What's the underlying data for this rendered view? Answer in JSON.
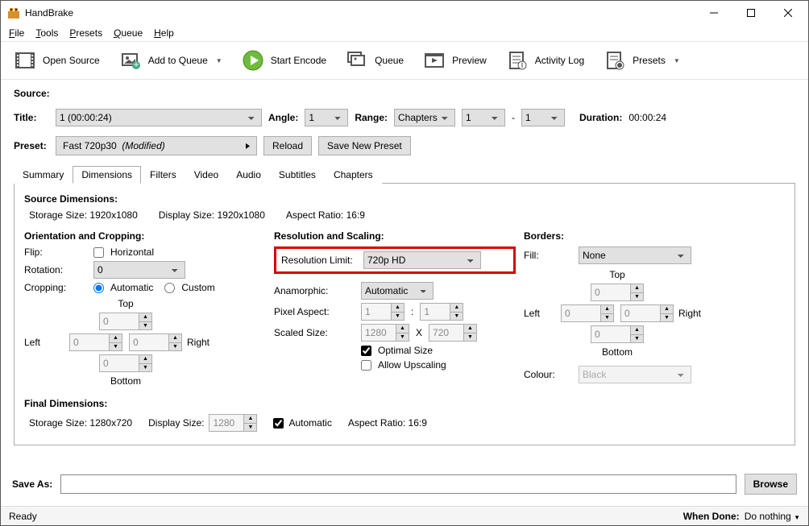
{
  "window": {
    "title": "HandBrake"
  },
  "menubar": {
    "file": "File",
    "tools": "Tools",
    "presets": "Presets",
    "queue": "Queue",
    "help": "Help"
  },
  "toolbar": {
    "open_source": "Open Source",
    "add_queue": "Add to Queue",
    "start_encode": "Start Encode",
    "queue": "Queue",
    "preview": "Preview",
    "activity": "Activity Log",
    "presets": "Presets"
  },
  "sourceRow": {
    "label": "Source:"
  },
  "titleRow": {
    "label": "Title:",
    "title_value": "1  (00:00:24)",
    "angle_label": "Angle:",
    "angle_value": "1",
    "range_label": "Range:",
    "range_type": "Chapters",
    "range_from": "1",
    "range_sep": "-",
    "range_to": "1",
    "duration_label": "Duration:",
    "duration_value": "00:00:24"
  },
  "presetRow": {
    "label": "Preset:",
    "value": "Fast 720p30",
    "modified": "(Modified)",
    "reload": "Reload",
    "save_new": "Save New Preset"
  },
  "tabs": {
    "summary": "Summary",
    "dimensions": "Dimensions",
    "filters": "Filters",
    "video": "Video",
    "audio": "Audio",
    "subtitles": "Subtitles",
    "chapters": "Chapters"
  },
  "dimensions": {
    "source_head": "Source Dimensions:",
    "storage_size_lbl": "Storage Size:",
    "storage_size_val": "1920x1080",
    "display_size_lbl": "Display Size:",
    "display_size_val": "1920x1080",
    "aspect_lbl": "Aspect Ratio:",
    "aspect_val": "16:9",
    "orient_head": "Orientation and Cropping:",
    "flip_lbl": "Flip:",
    "horizontal": "Horizontal",
    "rotation_lbl": "Rotation:",
    "rotation_val": "0",
    "cropping_lbl": "Cropping:",
    "automatic": "Automatic",
    "custom": "Custom",
    "top": "Top",
    "bottom": "Bottom",
    "left": "Left",
    "right": "Right",
    "crop_t": "0",
    "crop_b": "0",
    "crop_l": "0",
    "crop_r": "0",
    "res_head": "Resolution and Scaling:",
    "res_limit_lbl": "Resolution Limit:",
    "res_limit_val": "720p HD",
    "anam_lbl": "Anamorphic:",
    "anam_val": "Automatic",
    "pixasp_lbl": "Pixel Aspect:",
    "pixasp_a": "1",
    "pixasp_colon": ":",
    "pixasp_b": "1",
    "scaled_lbl": "Scaled Size:",
    "scaled_w": "1280",
    "scaled_x": "X",
    "scaled_h": "720",
    "optimal": "Optimal Size",
    "allow_up": "Allow Upscaling",
    "borders_head": "Borders:",
    "fill_lbl": "Fill:",
    "fill_val": "None",
    "bord_t": "0",
    "bord_b": "0",
    "bord_l": "0",
    "bord_r": "0",
    "colour_lbl": "Colour:",
    "colour_val": "Black",
    "final_head": "Final Dimensions:",
    "final_storage": "1280x720",
    "final_display": "1280",
    "final_autolbl": "Automatic",
    "final_aspect": "16:9"
  },
  "saveas": {
    "label": "Save As:",
    "browse": "Browse"
  },
  "statusbar": {
    "ready": "Ready",
    "when_done_lbl": "When Done:",
    "when_done_val": "Do nothing"
  }
}
